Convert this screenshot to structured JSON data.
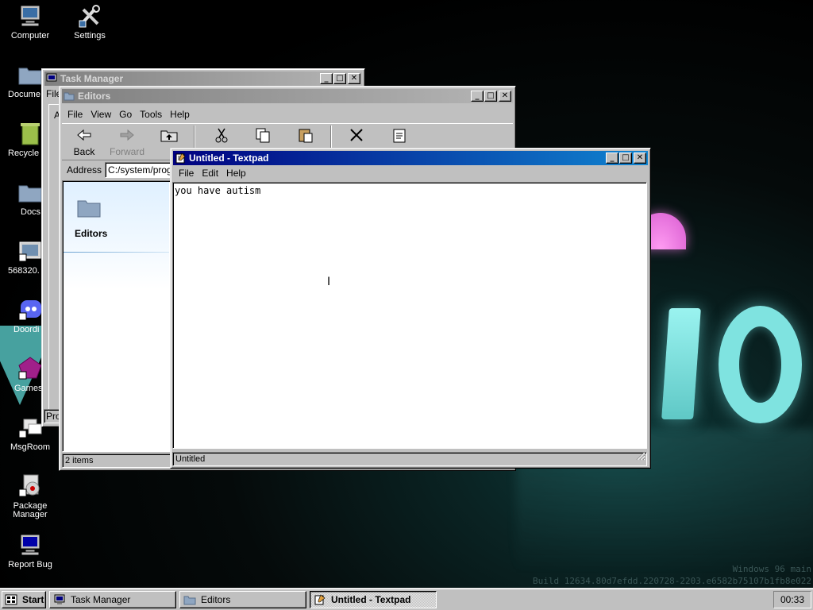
{
  "desktop": {
    "icons": [
      {
        "label": "Computer",
        "icon": "computer-icon"
      },
      {
        "label": "Settings",
        "icon": "settings-tools-icon"
      },
      {
        "label": "Docume",
        "icon": "folder-icon"
      },
      {
        "label": "Recycle",
        "icon": "recycle-bin-icon"
      },
      {
        "label": "Docs",
        "icon": "folder-icon"
      },
      {
        "label": "568320.",
        "icon": "image-file-icon"
      },
      {
        "label": "Doordi",
        "icon": "discord-icon"
      },
      {
        "label": "Games",
        "icon": "games-icon"
      },
      {
        "label": "MsgRoom",
        "icon": "msgroom-icon"
      },
      {
        "label": "Package Manager",
        "icon": "package-manager-icon"
      },
      {
        "label": "Report Bug",
        "icon": "report-bug-icon"
      }
    ],
    "build_line1": "Windows 96 main",
    "build_line2": "Build 12634.80d7efdd.220728-2203.e6582b75107b1fb8e022"
  },
  "task_manager": {
    "title": "Task Manager",
    "menu_partial": "File",
    "tab_partial": "A",
    "bottom_partial": "Pro"
  },
  "explorer": {
    "title": "Editors",
    "menu": [
      "File",
      "View",
      "Go",
      "Tools",
      "Help"
    ],
    "toolbar": {
      "back": "Back",
      "forward": "Forward",
      "up": "U"
    },
    "address_label": "Address",
    "address_value": "C:/system/programs/Editors",
    "sidebar_title": "Editors",
    "status": "2 items"
  },
  "textpad": {
    "title": "Untitled - Textpad",
    "menu": [
      "File",
      "Edit",
      "Help"
    ],
    "content": "you have autism",
    "status": "Untitled"
  },
  "taskbar": {
    "start_label": "Start",
    "items": [
      {
        "label": "Task Manager",
        "active": false
      },
      {
        "label": "Editors",
        "active": false
      },
      {
        "label": "Untitled - Textpad",
        "active": true
      }
    ],
    "clock": "00:33"
  }
}
